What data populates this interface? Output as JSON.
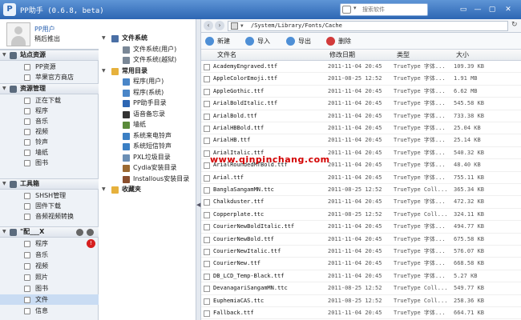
{
  "window": {
    "title": "PP助手 (0.6.8, beta)",
    "app_icon_letter": "P",
    "search_selector": "▾",
    "search_placeholder": "搜索软件",
    "controls": [
      "▭",
      "—",
      "▢",
      "✕"
    ]
  },
  "user": {
    "name": "PP用户",
    "status": "稍后推出"
  },
  "sidebar": {
    "sections": [
      {
        "label": "站点资源",
        "items": [
          {
            "label": "PP资源"
          },
          {
            "label": "苹果官方商店"
          }
        ]
      },
      {
        "label": "资源管理",
        "items": [
          {
            "label": "正在下载"
          },
          {
            "label": "程序"
          },
          {
            "label": "音乐"
          },
          {
            "label": "视频"
          },
          {
            "label": "铃声"
          },
          {
            "label": "墙纸"
          },
          {
            "label": "图书"
          }
        ]
      },
      {
        "label": "工具箱",
        "items": [
          {
            "label": "SHSH管理"
          },
          {
            "label": "固件下载"
          },
          {
            "label": "音频视频转换"
          }
        ]
      },
      {
        "label": "\"配___X",
        "items": [
          {
            "label": "程序",
            "badge": "!"
          },
          {
            "label": "音乐"
          },
          {
            "label": "视频"
          },
          {
            "label": "照片"
          },
          {
            "label": "图书"
          },
          {
            "label": "文件",
            "selected": true
          },
          {
            "label": "信息"
          }
        ]
      }
    ]
  },
  "tree": {
    "nodes": [
      {
        "label": "文件系统",
        "head": true,
        "color": "#4a6fa5"
      },
      {
        "label": "文件系统(用户)",
        "head": false,
        "color": "#7a8796"
      },
      {
        "label": "文件系统(越狱)",
        "head": false,
        "color": "#7a8796"
      },
      {
        "label": "常用目录",
        "head": true,
        "color": "#e6b13c"
      },
      {
        "label": "程序(用户)",
        "head": false,
        "color": "#4a86c8"
      },
      {
        "label": "程序(系统)",
        "head": false,
        "color": "#4a86c8"
      },
      {
        "label": "PP助手目录",
        "head": false,
        "color": "#2d66b3"
      },
      {
        "label": "语音备忘录",
        "head": false,
        "color": "#333333"
      },
      {
        "label": "墙纸",
        "head": false,
        "color": "#5a8a3a"
      },
      {
        "label": "系统来电铃声",
        "head": false,
        "color": "#3b7fc4"
      },
      {
        "label": "系统短信铃声",
        "head": false,
        "color": "#3b7fc4"
      },
      {
        "label": "PXL垃圾目录",
        "head": false,
        "color": "#6b8fb5"
      },
      {
        "label": "Cydia安装目录",
        "head": false,
        "color": "#9c6a32"
      },
      {
        "label": "Installous安装目录",
        "head": false,
        "color": "#8a4f2e"
      },
      {
        "label": "收藏夹",
        "head": true,
        "color": "#e6b13c"
      }
    ]
  },
  "address": {
    "back": "‹",
    "forward": "›",
    "path": "/System/Library/Fonts/Cache",
    "refresh": "↻"
  },
  "toolbar": [
    {
      "label": "新建",
      "color": "#4e8fd6"
    },
    {
      "label": "导入",
      "color": "#4e8fd6"
    },
    {
      "label": "导出",
      "color": "#4e8fd6"
    },
    {
      "label": "删除",
      "color": "#d23b3b"
    }
  ],
  "table": {
    "headers": [
      "文件名",
      "修改日期",
      "类型",
      "大小"
    ],
    "rows": [
      {
        "name": "AcademyEngraved.ttf",
        "date": "2011-11-04 20:45",
        "type": "TrueType 字体...",
        "size": "109.39 KB"
      },
      {
        "name": "AppleColorEmoji.ttf",
        "date": "2011-08-25 12:52",
        "type": "TrueType 字体...",
        "size": "1.91 MB"
      },
      {
        "name": "AppleGothic.ttf",
        "date": "2011-11-04 20:45",
        "type": "TrueType 字体...",
        "size": "6.62 MB"
      },
      {
        "name": "ArialBoldItalic.ttf",
        "date": "2011-11-04 20:45",
        "type": "TrueType 字体...",
        "size": "545.58 KB"
      },
      {
        "name": "ArialBold.ttf",
        "date": "2011-11-04 20:45",
        "type": "TrueType 字体...",
        "size": "733.38 KB"
      },
      {
        "name": "ArialHBBold.ttf",
        "date": "2011-11-04 20:45",
        "type": "TrueType 字体...",
        "size": "25.04 KB"
      },
      {
        "name": "ArialHB.ttf",
        "date": "2011-11-04 20:45",
        "type": "TrueType 字体...",
        "size": "25.14 KB"
      },
      {
        "name": "ArialItalic.ttf",
        "date": "2011-11-04 20:45",
        "type": "TrueType 字体...",
        "size": "540.32 KB"
      },
      {
        "name": "ArialRoundedMTBold.ttf",
        "date": "2011-11-04 20:45",
        "type": "TrueType 字体...",
        "size": "48.40 KB"
      },
      {
        "name": "Arial.ttf",
        "date": "2011-11-04 20:45",
        "type": "TrueType 字体...",
        "size": "755.11 KB"
      },
      {
        "name": "BanglaSangamMN.ttc",
        "date": "2011-08-25 12:52",
        "type": "TrueType Coll...",
        "size": "365.34 KB"
      },
      {
        "name": "Chalkduster.ttf",
        "date": "2011-11-04 20:45",
        "type": "TrueType 字体...",
        "size": "472.32 KB"
      },
      {
        "name": "Copperplate.ttc",
        "date": "2011-08-25 12:52",
        "type": "TrueType Coll...",
        "size": "324.11 KB"
      },
      {
        "name": "CourierNewBoldItalic.ttf",
        "date": "2011-11-04 20:45",
        "type": "TrueType 字体...",
        "size": "494.77 KB"
      },
      {
        "name": "CourierNewBold.ttf",
        "date": "2011-11-04 20:45",
        "type": "TrueType 字体...",
        "size": "675.58 KB"
      },
      {
        "name": "CourierNewItalic.ttf",
        "date": "2011-11-04 20:45",
        "type": "TrueType 字体...",
        "size": "576.07 KB"
      },
      {
        "name": "CourierNew.ttf",
        "date": "2011-11-04 20:45",
        "type": "TrueType 字体...",
        "size": "668.58 KB"
      },
      {
        "name": "DB_LCD_Temp-Black.ttf",
        "date": "2011-11-04 20:45",
        "type": "TrueType 字体...",
        "size": "5.27 KB"
      },
      {
        "name": "DevanagariSangamMN.ttc",
        "date": "2011-08-25 12:52",
        "type": "TrueType Coll...",
        "size": "549.77 KB"
      },
      {
        "name": "EuphemiaCAS.ttc",
        "date": "2011-08-25 12:52",
        "type": "TrueType Coll...",
        "size": "258.36 KB"
      },
      {
        "name": "Fallback.ttf",
        "date": "2011-11-04 20:45",
        "type": "TrueType 字体...",
        "size": "664.71 KB"
      }
    ]
  },
  "watermark": "www.qinpinchang.com"
}
